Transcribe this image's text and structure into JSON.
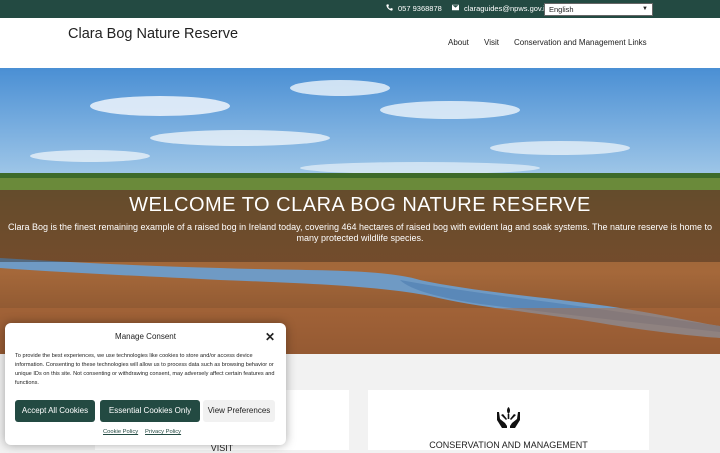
{
  "topbar": {
    "phone": "057 9368878",
    "email": "claraguides@npws.gov.ie",
    "language": "English"
  },
  "header": {
    "site_title": "Clara Bog Nature Reserve",
    "nav": [
      "About",
      "Visit",
      "Conservation and Management",
      "Links"
    ]
  },
  "hero": {
    "title": "WELCOME TO CLARA BOG NATURE RESERVE",
    "text": "Clara Bog is the finest remaining example of a raised bog in Ireland today, covering 464 hectares of raised bog with evident lag and soak systems. The nature reserve is home to many protected wildlife species."
  },
  "cards": [
    {
      "title": "VISIT",
      "icon": "visit-icon"
    },
    {
      "title": "CONSERVATION AND MANAGEMENT",
      "icon": "hands-plant-icon"
    }
  ],
  "consent": {
    "title": "Manage Consent",
    "text": "To provide the best experiences, we use technologies like cookies to store and/or access device information. Consenting to these technologies will allow us to process data such as browsing behavior or unique IDs on this site. Not consenting or withdrawing consent, may adversely affect certain features and functions.",
    "accept_label": "Accept All Cookies",
    "essential_label": "Essential Cookies Only",
    "preferences_label": "View Preferences",
    "cookie_policy": "Cookie Policy",
    "privacy_policy": "Privacy Policy"
  },
  "colors": {
    "brand": "#234a42"
  }
}
